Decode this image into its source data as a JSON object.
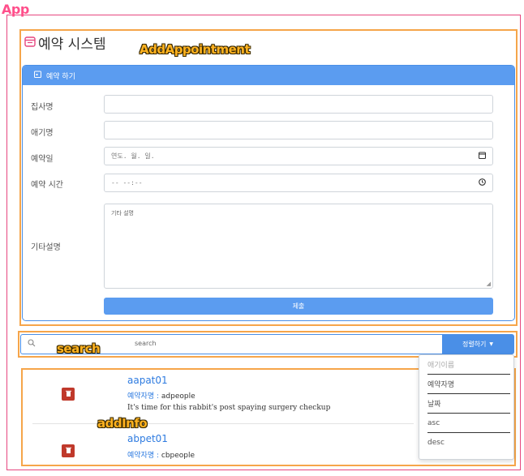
{
  "labels": {
    "app": "App",
    "add_appointment": "AddAppointment",
    "search": "search",
    "add_info": "addInfo"
  },
  "title": "예약 시스템",
  "form": {
    "header": "예약 하기",
    "fields": [
      {
        "label": "집사명",
        "value": ""
      },
      {
        "label": "애기명",
        "value": ""
      },
      {
        "label": "예약일",
        "value": "연도. 월. 일."
      },
      {
        "label": "예약 시간",
        "value": "-- --:--"
      }
    ],
    "notes_label": "기타설명",
    "notes_placeholder": "기타 설명",
    "submit": "제출"
  },
  "search": {
    "value": "search",
    "sort_button": "정렬하기"
  },
  "sort_menu": [
    "애기이름",
    "예약자명",
    "날짜",
    "asc",
    "desc"
  ],
  "appointments": [
    {
      "pet": "aapat01",
      "owner_label": "예약자명 :",
      "owner": "adpeople",
      "note": "It's time for this rabbit's post spaying surgery checkup"
    },
    {
      "pet": "abpet01",
      "owner_label": "예약자명 :",
      "owner": "cbpeople",
      "note": ""
    }
  ],
  "colors": {
    "primary": "#5b9cf0",
    "danger": "#c0392b",
    "outline_app": "#e6467f",
    "outline_comp": "#f6a54a"
  }
}
